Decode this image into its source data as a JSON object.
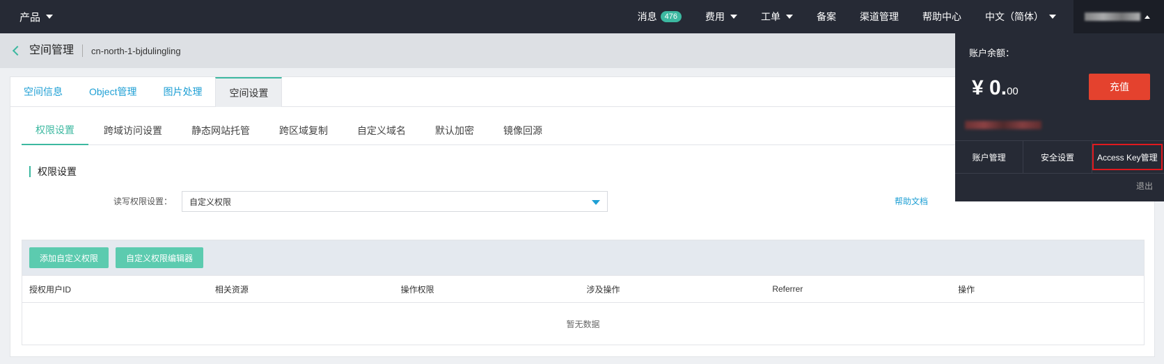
{
  "topnav": {
    "product_label": "产品",
    "messages_label": "消息",
    "messages_count": "476",
    "items": [
      {
        "label": "费用",
        "dropdown": true
      },
      {
        "label": "工单",
        "dropdown": true
      },
      {
        "label": "备案",
        "dropdown": false
      },
      {
        "label": "渠道管理",
        "dropdown": false
      },
      {
        "label": "帮助中心",
        "dropdown": false
      },
      {
        "label": "中文（简体）",
        "dropdown": true
      }
    ]
  },
  "breadcrumb": {
    "title": "空间管理",
    "bucket": "cn-north-1-bjdulingling"
  },
  "main_tabs": [
    "空间信息",
    "Object管理",
    "图片处理",
    "空间设置"
  ],
  "main_tabs_active": 3,
  "sub_tabs": [
    "权限设置",
    "跨域访问设置",
    "静态网站托管",
    "跨区域复制",
    "自定义域名",
    "默认加密",
    "镜像回源"
  ],
  "sub_tabs_active": 0,
  "section_title": "权限设置",
  "permission": {
    "label": "读写权限设置：",
    "selected": "自定义权限",
    "help_link": "帮助文档"
  },
  "table": {
    "buttons": [
      "添加自定义权限",
      "自定义权限编辑器"
    ],
    "columns": [
      "授权用户ID",
      "相关资源",
      "操作权限",
      "涉及操作",
      "Referrer",
      "操作"
    ],
    "empty_text": "暂无数据"
  },
  "account": {
    "balance_label": "账户余额：",
    "currency": "¥",
    "amount_int": "0.",
    "amount_dec": "00",
    "recharge_label": "充值",
    "links": [
      "账户管理",
      "安全设置",
      "Access Key管理"
    ],
    "logout_label": "退出"
  },
  "colors": {
    "nav_bg": "#262a35",
    "accent": "#3cb8a0",
    "link": "#1e9fd4",
    "recharge": "#e4422e",
    "highlight_box": "#e0191e"
  }
}
